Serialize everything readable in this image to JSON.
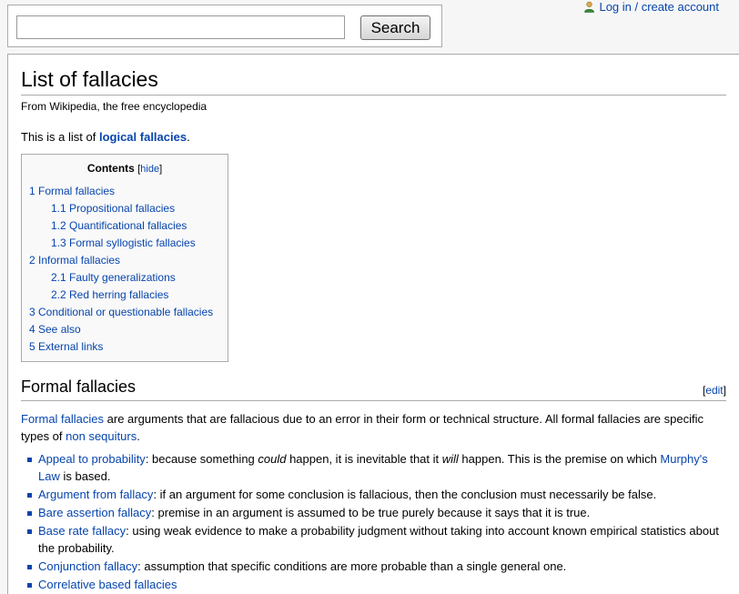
{
  "search": {
    "value": "",
    "button_label": "Search"
  },
  "personal": {
    "login_label": "Log in / create account"
  },
  "page": {
    "title": "List of fallacies",
    "tagline": "From Wikipedia, the free encyclopedia",
    "intro_prefix": "This is a list of ",
    "intro_link": "logical fallacies",
    "intro_suffix": "."
  },
  "toc": {
    "title": "Contents",
    "hide_open": "[",
    "hide_label": "hide",
    "hide_close": "]",
    "items": [
      {
        "label": "1 Formal fallacies",
        "level": 1
      },
      {
        "label": "1.1 Propositional fallacies",
        "level": 2
      },
      {
        "label": "1.2 Quantificational fallacies",
        "level": 2
      },
      {
        "label": "1.3 Formal syllogistic fallacies",
        "level": 2
      },
      {
        "label": "2 Informal fallacies",
        "level": 1
      },
      {
        "label": "2.1 Faulty generalizations",
        "level": 2
      },
      {
        "label": "2.2 Red herring fallacies",
        "level": 2
      },
      {
        "label": "3 Conditional or questionable fallacies",
        "level": 1
      },
      {
        "label": "4 See also",
        "level": 1
      },
      {
        "label": "5 External links",
        "level": 1
      }
    ]
  },
  "section": {
    "heading": "Formal fallacies",
    "edit_open": "[",
    "edit_label": "edit",
    "edit_close": "]",
    "intro_link": "Formal fallacies",
    "intro_text": " are arguments that are fallacious due to an error in their form or technical structure. All formal fallacies are specific types of ",
    "intro_link2": "non sequiturs",
    "intro_end": ".",
    "items": [
      {
        "link": "Appeal to probability",
        "text_a": ": because something ",
        "em1": "could",
        "text_b": " happen, it is inevitable that it ",
        "em2": "will",
        "text_c": " happen. This is the premise on which ",
        "link2": "Murphy's Law",
        "text_d": " is based."
      },
      {
        "link": "Argument from fallacy",
        "text": ": if an argument for some conclusion is fallacious, then the conclusion must necessarily be false."
      },
      {
        "link": "Bare assertion fallacy",
        "text": ": premise in an argument is assumed to be true purely because it says that it is true."
      },
      {
        "link": "Base rate fallacy",
        "text": ": using weak evidence to make a probability judgment without taking into account known empirical statistics about the probability."
      },
      {
        "link": "Conjunction fallacy",
        "text": ": assumption that specific conditions are more probable than a single general one."
      },
      {
        "link": "Correlative based fallacies",
        "text": ""
      }
    ]
  },
  "colors": {
    "link": "#0645ad",
    "border": "#aaaaaa",
    "toc_bg": "#f9f9f9",
    "page_bg": "#f6f6f6"
  }
}
